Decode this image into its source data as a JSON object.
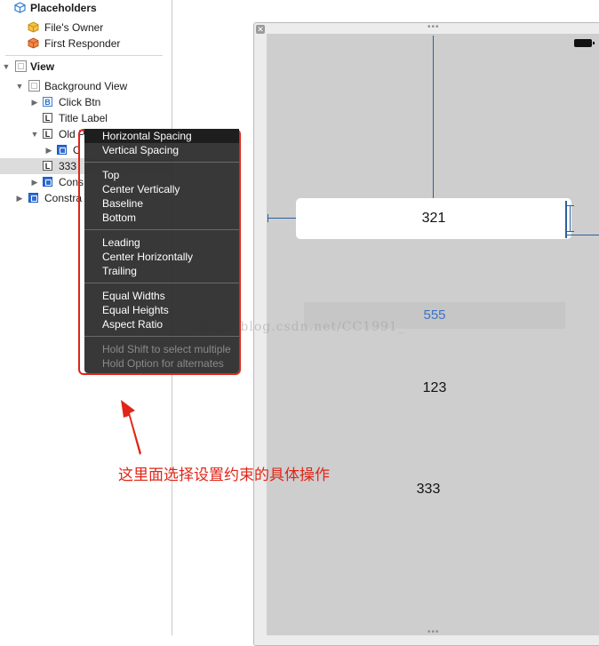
{
  "outline": {
    "placeholders_header": "Placeholders",
    "files_owner": "File's Owner",
    "first_responder": "First Responder",
    "view": "View",
    "background_view": "Background View",
    "click_btn": "Click Btn",
    "title_label": "Title Label",
    "old_partial": "Old P",
    "child_partial": "C",
    "label_333_partial": "333",
    "constraints_partial": "Cons",
    "constraints2_partial": "Constra"
  },
  "canvas": {
    "field_value": "321",
    "label_555": "555",
    "label_123": "123",
    "label_333": "333",
    "watermark": "http://blog.csdn.net/CC1991_"
  },
  "menu": {
    "horizontal_spacing": "Horizontal Spacing",
    "vertical_spacing": "Vertical Spacing",
    "top": "Top",
    "center_vertically": "Center Vertically",
    "baseline": "Baseline",
    "bottom": "Bottom",
    "leading": "Leading",
    "center_horizontally": "Center Horizontally",
    "trailing": "Trailing",
    "equal_widths": "Equal Widths",
    "equal_heights": "Equal Heights",
    "aspect_ratio": "Aspect Ratio",
    "hint_shift": "Hold Shift to select multiple",
    "hint_option": "Hold Option for alternates"
  },
  "annotation": {
    "text": "这里面选择设置约束的具体操作"
  },
  "colors": {
    "annotation_red": "#e02518",
    "constraint_blue": "#2d5f9e",
    "link_blue": "#3a73c8"
  }
}
